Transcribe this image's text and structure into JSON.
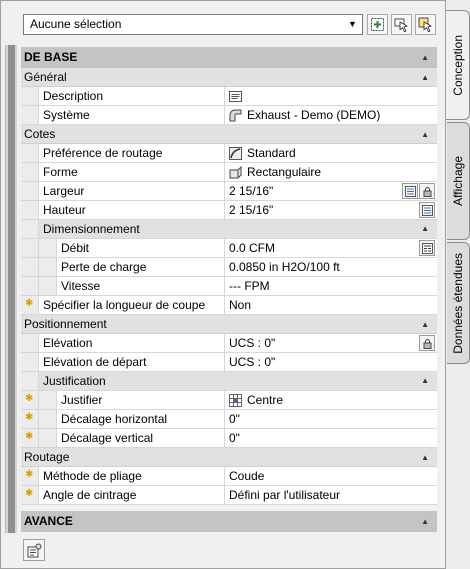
{
  "toolbar": {
    "selection": "Aucune sélection",
    "buttons": [
      "quick-select-icon",
      "select-objects-icon",
      "toggle-pickadd-icon"
    ]
  },
  "sections": {
    "base": "DE BASE",
    "avance": "AVANCE"
  },
  "general": {
    "title": "Général",
    "description_label": "Description",
    "description_value": "",
    "systeme_label": "Système",
    "systeme_value": "Exhaust - Demo (DEMO)"
  },
  "cotes": {
    "title": "Cotes",
    "pref_label": "Préférence de routage",
    "pref_value": "Standard",
    "forme_label": "Forme",
    "forme_value": "Rectangulaire",
    "largeur_label": "Largeur",
    "largeur_value": "2 15/16\"",
    "hauteur_label": "Hauteur",
    "hauteur_value": "2 15/16\"",
    "dim_title": "Dimensionnement",
    "debit_label": "Débit",
    "debit_value": "0.0 CFM",
    "perte_label": "Perte de charge",
    "perte_value": "0.0850 in H2O/100 ft",
    "vitesse_label": "Vitesse",
    "vitesse_value": "--- FPM",
    "coupe_label": "Spécifier la longueur de coupe",
    "coupe_value": "Non"
  },
  "position": {
    "title": "Positionnement",
    "elev_label": "Elévation",
    "elev_value": "UCS : 0\"",
    "elevdep_label": "Elévation de départ",
    "elevdep_value": "UCS : 0\"",
    "just_title": "Justification",
    "justifier_label": "Justifier",
    "justifier_value": "Centre",
    "dech_label": "Décalage horizontal",
    "dech_value": "0\"",
    "decv_label": "Décalage vertical",
    "decv_value": "0\""
  },
  "routage": {
    "title": "Routage",
    "pliage_label": "Méthode de pliage",
    "pliage_value": "Coude",
    "angle_label": "Angle de cintrage",
    "angle_value": "Défini par l'utilisateur"
  },
  "tabs": [
    "Conception",
    "Affichage",
    "Données étendues"
  ],
  "colors": {
    "asterisk": "#e89a00",
    "section_bg": "#d0d0d0",
    "category_bg": "#e1e1e1"
  }
}
